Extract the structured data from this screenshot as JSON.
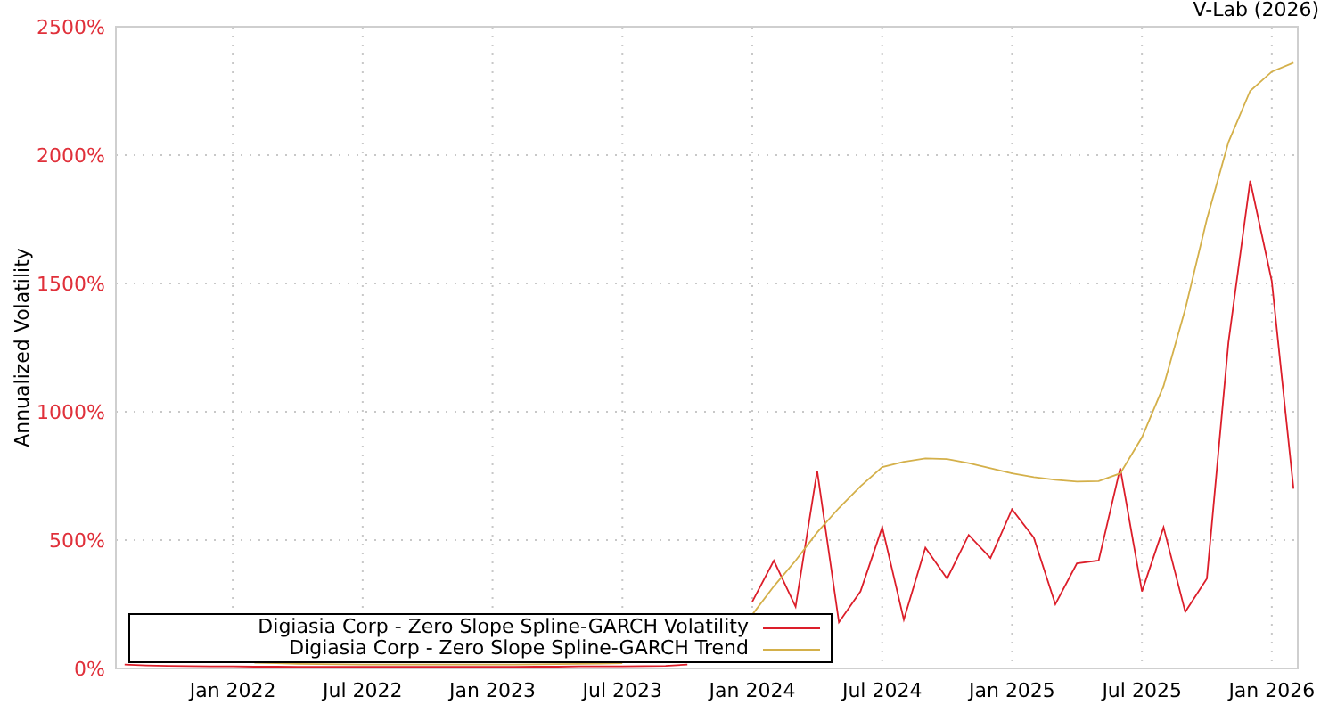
{
  "credit": "V-Lab (2026)",
  "chart_data": {
    "type": "line",
    "grid": true,
    "ylabel": "Annualized Volatility",
    "ylim": [
      0,
      2500
    ],
    "yticks": [
      {
        "value": 0,
        "label": "0%"
      },
      {
        "value": 500,
        "label": "500%"
      },
      {
        "value": 1000,
        "label": "1000%"
      },
      {
        "value": 1500,
        "label": "1500%"
      },
      {
        "value": 2000,
        "label": "2000%"
      },
      {
        "value": 2500,
        "label": "2500%"
      }
    ],
    "categories": [
      null,
      null,
      null,
      null,
      null,
      "Jan 2022",
      null,
      null,
      null,
      null,
      null,
      "Jul 2022",
      null,
      null,
      null,
      null,
      null,
      "Jan 2023",
      null,
      null,
      null,
      null,
      null,
      "Jul 2023",
      null,
      null,
      null,
      null,
      null,
      "Jan 2024",
      null,
      null,
      null,
      null,
      null,
      "Jul 2024",
      null,
      null,
      null,
      null,
      null,
      "Jan 2025",
      null,
      null,
      null,
      null,
      null,
      "Jul 2025",
      null,
      null,
      null,
      null,
      null,
      "Jan 2026",
      null
    ],
    "series": [
      {
        "name": "Digiasia Corp - Zero Slope Spline-GARCH Volatility",
        "color": "#dc1e2a",
        "values": [
          15,
          12,
          10,
          9,
          8,
          8,
          7,
          7,
          6,
          6,
          6,
          6,
          6,
          6,
          6,
          6,
          6,
          6,
          6,
          7,
          7,
          8,
          8,
          8,
          9,
          10,
          15,
          null,
          null,
          260,
          420,
          240,
          770,
          180,
          300,
          550,
          190,
          470,
          350,
          520,
          430,
          620,
          510,
          250,
          410,
          420,
          780,
          300,
          550,
          220,
          350,
          1270,
          1900,
          1510,
          700
        ]
      },
      {
        "name": "Digiasia Corp - Zero Slope Spline-GARCH Trend",
        "color": "#d4b04a",
        "values": [
          null,
          null,
          null,
          null,
          null,
          null,
          22,
          20,
          18,
          17,
          16,
          15,
          15,
          15,
          15,
          15,
          15,
          15,
          15,
          16,
          17,
          18,
          19,
          20,
          null,
          null,
          null,
          null,
          null,
          210,
          320,
          420,
          530,
          625,
          710,
          785,
          805,
          818,
          815,
          800,
          780,
          760,
          745,
          735,
          728,
          730,
          760,
          900,
          1100,
          1400,
          1750,
          2050,
          2250,
          2325,
          2360
        ]
      }
    ]
  }
}
